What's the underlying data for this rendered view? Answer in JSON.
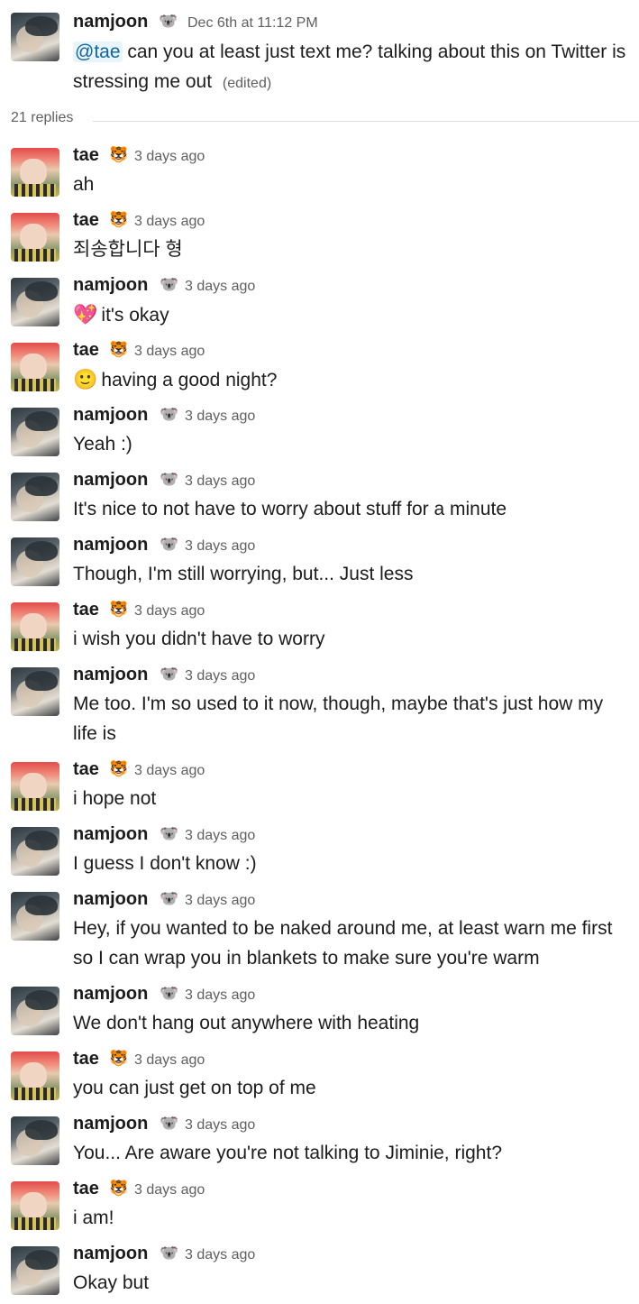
{
  "parent": {
    "author": "namjoon",
    "author_emoji": "🐨",
    "timestamp": "Dec 6th at 11:12 PM",
    "mention": "@tae",
    "text": "can you at least just text me? talking about this on Twitter is stressing me out",
    "edited": "(edited)"
  },
  "replies_label": "21 replies",
  "messages": [
    {
      "author": "tae",
      "emoji": "🐯",
      "time": "3 days ago",
      "prefix": "",
      "text": "ah"
    },
    {
      "author": "tae",
      "emoji": "🐯",
      "time": "3 days ago",
      "prefix": "",
      "text": "죄송합니다 형"
    },
    {
      "author": "namjoon",
      "emoji": "🐨",
      "time": "3 days ago",
      "prefix": "💖",
      "text": "it's okay"
    },
    {
      "author": "tae",
      "emoji": "🐯",
      "time": "3 days ago",
      "prefix": "🙂",
      "text": "having a good night?"
    },
    {
      "author": "namjoon",
      "emoji": "🐨",
      "time": "3 days ago",
      "prefix": "",
      "text": "Yeah :)"
    },
    {
      "author": "namjoon",
      "emoji": "🐨",
      "time": "3 days ago",
      "prefix": "",
      "text": "It's nice to not have to worry about stuff for a minute"
    },
    {
      "author": "namjoon",
      "emoji": "🐨",
      "time": "3 days ago",
      "prefix": "",
      "text": "Though, I'm still worrying, but... Just less"
    },
    {
      "author": "tae",
      "emoji": "🐯",
      "time": "3 days ago",
      "prefix": "",
      "text": "i wish you didn't have to worry"
    },
    {
      "author": "namjoon",
      "emoji": "🐨",
      "time": "3 days ago",
      "prefix": "",
      "text": "Me too. I'm so used to it now, though, maybe that's just how my life is"
    },
    {
      "author": "tae",
      "emoji": "🐯",
      "time": "3 days ago",
      "prefix": "",
      "text": "i hope not"
    },
    {
      "author": "namjoon",
      "emoji": "🐨",
      "time": "3 days ago",
      "prefix": "",
      "text": "I guess I don't know :)"
    },
    {
      "author": "namjoon",
      "emoji": "🐨",
      "time": "3 days ago",
      "prefix": "",
      "text": "Hey, if you wanted to be naked around me, at least warn me first so I can wrap you in blankets to make sure you're warm"
    },
    {
      "author": "namjoon",
      "emoji": "🐨",
      "time": "3 days ago",
      "prefix": "",
      "text": "We don't hang out anywhere with heating"
    },
    {
      "author": "tae",
      "emoji": "🐯",
      "time": "3 days ago",
      "prefix": "",
      "text": "you can just get on top of me"
    },
    {
      "author": "namjoon",
      "emoji": "🐨",
      "time": "3 days ago",
      "prefix": "",
      "text": "You... Are aware you're not talking to Jiminie, right?"
    },
    {
      "author": "tae",
      "emoji": "🐯",
      "time": "3 days ago",
      "prefix": "",
      "text": "i am!"
    },
    {
      "author": "namjoon",
      "emoji": "🐨",
      "time": "3 days ago",
      "prefix": "",
      "text": "Okay but"
    }
  ]
}
